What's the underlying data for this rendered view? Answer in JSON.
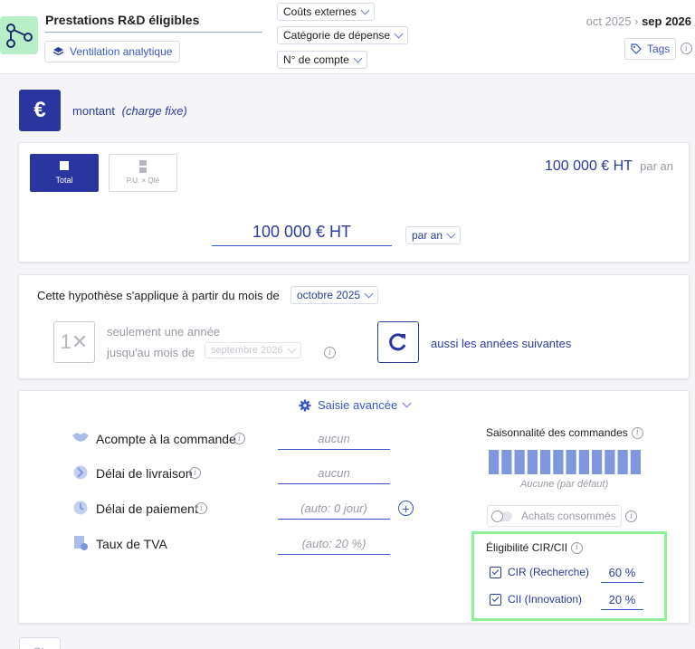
{
  "header": {
    "title": "Prestations R&D éligibles",
    "analytic_label": "Ventilation analytique",
    "filters": [
      "Coûts externes",
      "Catégorie de dépense",
      "N° de compte"
    ],
    "period_start": "oct 2025",
    "period_sep": "›",
    "period_end": "sep 2026",
    "tags_label": "Tags"
  },
  "amount": {
    "icon_symbol": "€",
    "label": "montant",
    "note": "(charge fixe)",
    "mode_total": "Total",
    "mode_unit": "P.U. × Qté",
    "summary_value": "100 000 € HT",
    "summary_period": "par an",
    "input_value": "100 000 € HT",
    "period_select": "par an"
  },
  "hypothesis": {
    "intro": "Cette hypothèse s'applique à partir du mois de",
    "start_month": "octobre 2025",
    "once_icon": "1✕",
    "once_label": "seulement une année",
    "until_label": "jusqu'au mois de",
    "until_month": "septembre 2026",
    "repeat_label": "aussi les années suivantes"
  },
  "advanced": {
    "toggle_label": "Saisie avancée",
    "fields": [
      {
        "label": "Acompte à la commande",
        "value": "aucun"
      },
      {
        "label": "Délai de livraison",
        "value": "aucun"
      },
      {
        "label": "Délai de paiement",
        "value": "(auto: 0 jour)"
      },
      {
        "label": "Taux de TVA",
        "value": "(auto: 20 %)"
      }
    ],
    "seasonality_title": "Saisonnalité des commandes",
    "seasonality_caption": "Aucune (par défaut)",
    "seasonality_bars": [
      1,
      1,
      1,
      1,
      1,
      1,
      1,
      1,
      1,
      1,
      1,
      1
    ],
    "consumed_label": "Achats consommés",
    "eligibility_title": "Éligibilité CIR/CII",
    "eligibility": [
      {
        "label": "CIR (Recherche)",
        "value": "60 %"
      },
      {
        "label": "CII (Innovation)",
        "value": "20 %"
      }
    ]
  },
  "footer": {
    "partial_label": "Ok"
  },
  "colors": {
    "navy": "#2b3b9f",
    "link": "#3a56c8",
    "highlight": "#8ef29a",
    "bar": "#7f97dd"
  }
}
